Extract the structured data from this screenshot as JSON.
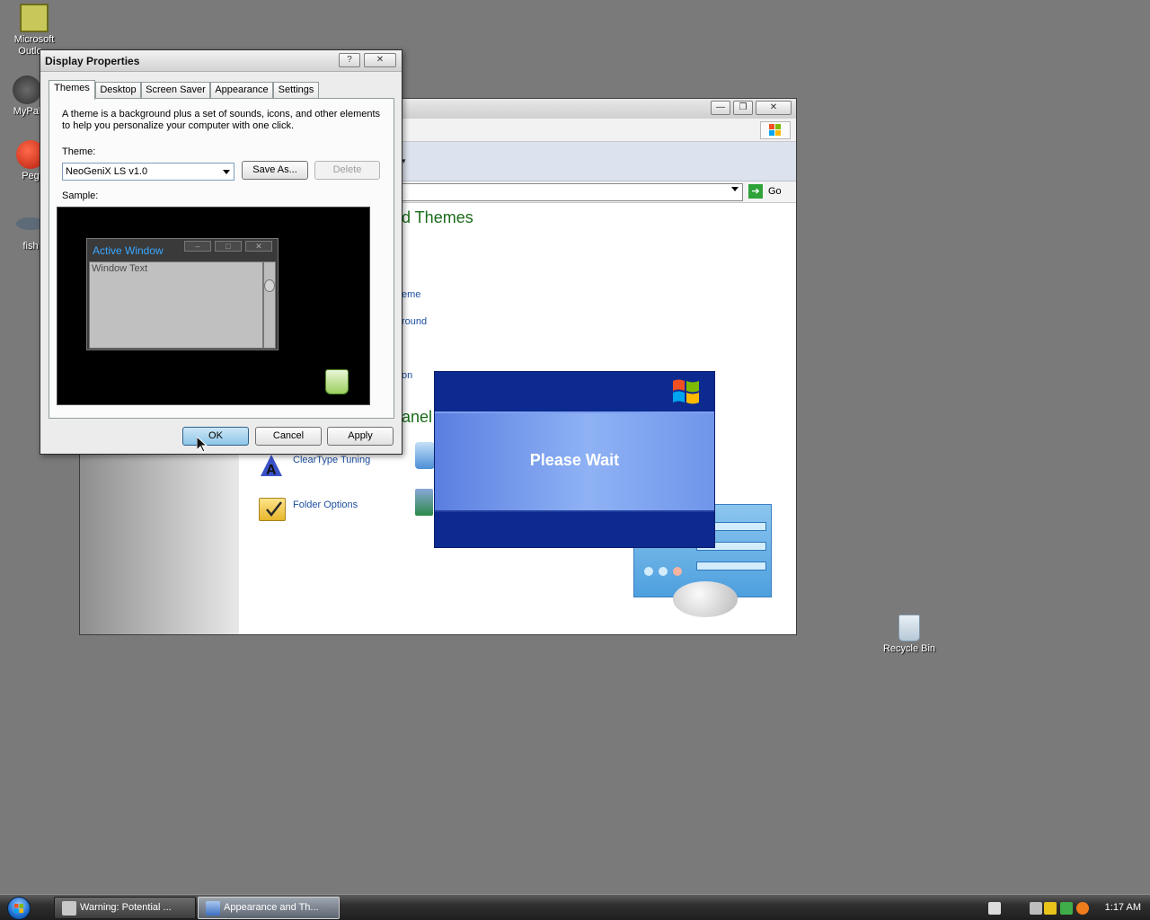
{
  "desktop": {
    "icons": [
      {
        "label": "Microsoft Outlo..."
      },
      {
        "label": "MyPal"
      },
      {
        "label": "Peg"
      },
      {
        "label": "fish"
      },
      {
        "label": "Recycle Bin"
      }
    ]
  },
  "cp_window": {
    "title_buttons": {
      "minimize": "—",
      "maximize": "❐",
      "close": "✕"
    },
    "address": {
      "go_label": "Go"
    },
    "heading": "d Themes",
    "task_links": [
      "eme",
      "round",
      "on"
    ],
    "see_also_heading": "anel",
    "cp_icons": [
      {
        "label": "ClearType Tuning"
      },
      {
        "label": "Folder Options"
      }
    ]
  },
  "dialog": {
    "title": "Display Properties",
    "title_buttons": {
      "help": "?",
      "close": "✕"
    },
    "tabs": [
      "Themes",
      "Desktop",
      "Screen Saver",
      "Appearance",
      "Settings"
    ],
    "active_tab": "Themes",
    "description": "A theme is a background plus a set of sounds, icons, and other elements to help you personalize your computer with one click.",
    "theme_label": "Theme:",
    "theme_value": "NeoGeniX LS v1.0",
    "save_as_label": "Save As...",
    "delete_label": "Delete",
    "sample_label": "Sample:",
    "sample": {
      "active_window_title": "Active Window",
      "window_text": "Window Text"
    },
    "ok_label": "OK",
    "cancel_label": "Cancel",
    "apply_label": "Apply"
  },
  "splash": {
    "text": "Please Wait"
  },
  "taskbar": {
    "buttons": [
      {
        "label": "Warning: Potential ..."
      },
      {
        "label": "Appearance and Th..."
      }
    ],
    "clock": "1:17 AM"
  }
}
